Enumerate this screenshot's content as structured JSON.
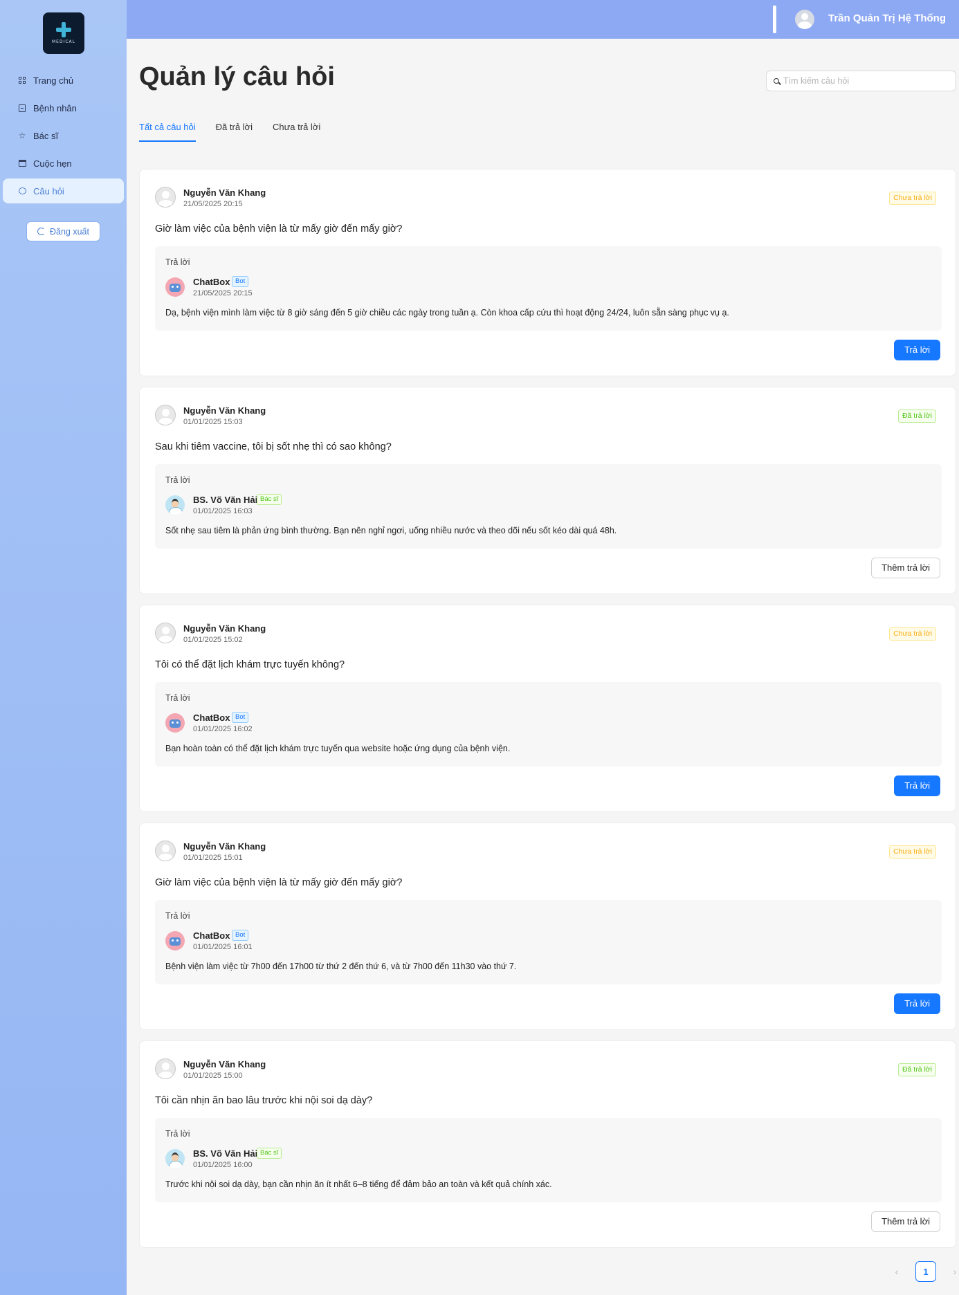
{
  "logo": {
    "text": "MEDICAL"
  },
  "sidebar": {
    "items": [
      {
        "label": "Trang chủ",
        "icon": "dashboard-icon"
      },
      {
        "label": "Bệnh nhân",
        "icon": "patient-icon"
      },
      {
        "label": "Bác sĩ",
        "icon": "star-icon"
      },
      {
        "label": "Cuộc hẹn",
        "icon": "calendar-icon"
      },
      {
        "label": "Câu hỏi",
        "icon": "chat-icon",
        "active": true
      }
    ],
    "logout_label": "Đăng xuất"
  },
  "header": {
    "username": "Trần Quản Trị Hệ Thống"
  },
  "main": {
    "title": "Quản lý câu hỏi",
    "search_placeholder": "Tìm kiếm câu hỏi",
    "tabs": [
      {
        "label": "Tất cả câu hỏi",
        "active": true
      },
      {
        "label": "Đã trả lời"
      },
      {
        "label": "Chưa trả lời"
      }
    ],
    "answer_label": "Trả lời",
    "questions": [
      {
        "author": "Nguyễn Văn Khang",
        "time": "21/05/2025 20:15",
        "status": "Chưa trả lời",
        "text": "Giờ làm việc của bệnh viện là từ mấy giờ đến mấy giờ?",
        "answer": {
          "name": "ChatBox",
          "role": "Bot",
          "time": "21/05/2025 20:15",
          "text": "Dạ, bệnh viện mình làm việc từ 8 giờ sáng đến 5 giờ chiều các ngày trong tuần ạ. Còn khoa cấp cứu thì hoạt động 24/24, luôn sẵn sàng phục vụ ạ."
        },
        "button": "Trả lời"
      },
      {
        "author": "Nguyễn Văn Khang",
        "time": "01/01/2025 15:03",
        "status": "Đã trả lời",
        "text": "Sau khi tiêm vaccine, tôi bị sốt nhẹ thì có sao không?",
        "answer": {
          "name": "BS. Võ Văn Hải",
          "role": "Bác sĩ",
          "time": "01/01/2025 16:03",
          "text": "Sốt nhẹ sau tiêm là phản ứng bình thường. Bạn nên nghỉ ngơi, uống nhiều nước và theo dõi nếu sốt kéo dài quá 48h."
        },
        "button": "Thêm trả lời"
      },
      {
        "author": "Nguyễn Văn Khang",
        "time": "01/01/2025 15:02",
        "status": "Chưa trả lời",
        "text": "Tôi có thể đặt lịch khám trực tuyến không?",
        "answer": {
          "name": "ChatBox",
          "role": "Bot",
          "time": "01/01/2025 16:02",
          "text": "Bạn hoàn toàn có thể đặt lịch khám trực tuyến qua website hoặc ứng dụng của bệnh viện."
        },
        "button": "Trả lời"
      },
      {
        "author": "Nguyễn Văn Khang",
        "time": "01/01/2025 15:01",
        "status": "Chưa trả lời",
        "text": "Giờ làm việc của bệnh viện là từ mấy giờ đến mấy giờ?",
        "answer": {
          "name": "ChatBox",
          "role": "Bot",
          "time": "01/01/2025 16:01",
          "text": "Bệnh viện làm việc từ 7h00 đến 17h00 từ thứ 2 đến thứ 6, và từ 7h00 đến 11h30 vào thứ 7."
        },
        "button": "Trả lời"
      },
      {
        "author": "Nguyễn Văn Khang",
        "time": "01/01/2025 15:00",
        "status": "Đã trả lời",
        "text": "Tôi cần nhịn ăn bao lâu trước khi nội soi dạ dày?",
        "answer": {
          "name": "BS. Võ Văn Hải",
          "role": "Bác sĩ",
          "time": "01/01/2025 16:00",
          "text": "Trước khi nội soi dạ dày, bạn cần nhịn ăn ít nhất 6–8 tiếng để đảm bảo an toàn và kết quả chính xác."
        },
        "button": "Thêm trả lời"
      }
    ]
  },
  "pagination": {
    "prev": "‹",
    "current": "1",
    "next": "›"
  },
  "colors": {
    "primary": "#1677ff",
    "sidebar": "#a9c6f6",
    "header": "#8ea9f4",
    "pending": "#faad14",
    "answered": "#52c41a"
  }
}
